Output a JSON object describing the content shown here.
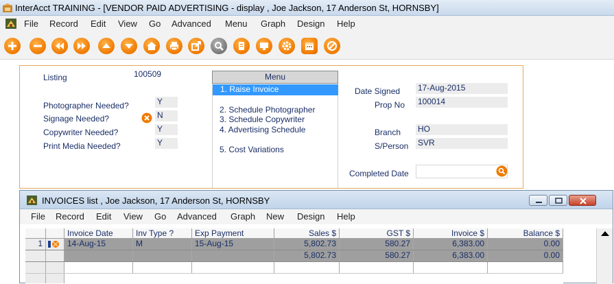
{
  "window": {
    "title": "InterAcct TRAINING - [VENDOR PAID ADVERTISING - display , Joe Jackson, 17 Anderson St, HORNSBY]"
  },
  "menubar": [
    "File",
    "Record",
    "Edit",
    "View",
    "Go",
    "Advanced",
    "Menu",
    "Graph",
    "Design",
    "Help"
  ],
  "toolbar": {
    "buttons": [
      "add-icon",
      "remove-icon",
      "rewind-icon",
      "fast-forward-icon",
      "up-icon",
      "down-icon",
      "home-icon",
      "print-icon",
      "export-icon",
      "search-icon",
      "notes-icon",
      "monitor-icon",
      "settings-icon",
      "calendar-icon",
      "cancel-icon"
    ]
  },
  "form": {
    "listing": {
      "label": "Listing",
      "value": "100509"
    },
    "photographer_needed": {
      "label": "Photographer Needed?",
      "value": "Y"
    },
    "signage_needed": {
      "label": "Signage Needed?",
      "value": "N"
    },
    "copywriter_needed": {
      "label": "Copywriter Needed?",
      "value": "Y"
    },
    "print_media_needed": {
      "label": "Print Media Needed?",
      "value": "Y"
    },
    "date_signed": {
      "label": "Date Signed",
      "value": "17-Aug-2015"
    },
    "prop_no": {
      "label": "Prop No",
      "value": "100014"
    },
    "branch": {
      "label": "Branch",
      "value": "HO"
    },
    "sperson": {
      "label": "S/Person",
      "value": "SVR"
    },
    "completed_date": {
      "label": "Completed Date",
      "value": ""
    }
  },
  "menu": {
    "header": "Menu",
    "items": [
      "1. Raise Invoice",
      "2. Schedule Photographer",
      "3. Schedule Copywriter",
      "4. Advertising Schedule",
      "5. Cost Variations"
    ]
  },
  "invoices": {
    "title": "INVOICES list , Joe Jackson, 17 Anderson St, HORNSBY",
    "menubar": [
      "File",
      "Record",
      "Edit",
      "View",
      "Go",
      "Advanced",
      "Graph",
      "New",
      "Design",
      "Help"
    ],
    "columns": [
      "Invoice Date",
      "Inv Type ?",
      "Exp Payment",
      "Sales $",
      "GST   $",
      "Invoice  $",
      "Balance  $"
    ],
    "rows": [
      {
        "num": "1",
        "invoice_date": "14-Aug-15",
        "inv_type": "M",
        "exp_payment": "15-Aug-15",
        "sales": "5,802.73",
        "gst": "580.27",
        "invoice": "6,383.00",
        "balance": "0.00"
      }
    ],
    "totals": {
      "sales": "5,802.73",
      "gst": "580.27",
      "invoice": "6,383.00",
      "balance": "0.00"
    }
  },
  "colors": {
    "accent_orange": "#f07a00",
    "selection_blue": "#3399ff",
    "form_border": "#e3a95c",
    "label_text": "#1a2e66"
  }
}
